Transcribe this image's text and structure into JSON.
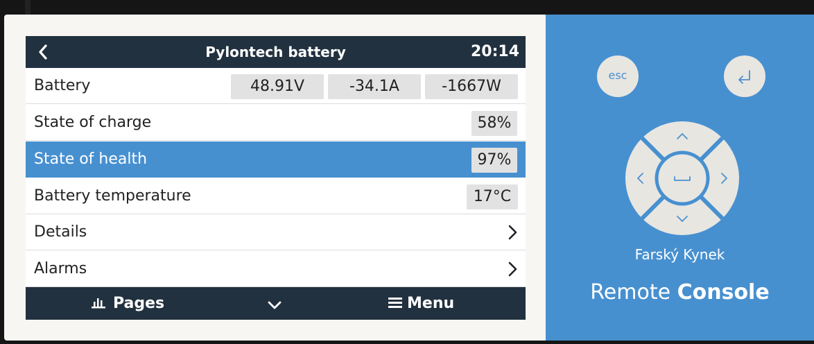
{
  "header": {
    "title": "Pylontech battery",
    "time": "20:14"
  },
  "rows": [
    {
      "label": "Battery",
      "values": [
        "48.91V",
        "-34.1A",
        "-1667W"
      ]
    },
    {
      "label": "State of charge",
      "value": "58%"
    },
    {
      "label": "State of health",
      "value": "97%",
      "selected": true
    },
    {
      "label": "Battery temperature",
      "value": "17°C"
    },
    {
      "label": "Details"
    },
    {
      "label": "Alarms"
    }
  ],
  "footer": {
    "pages_label": "Pages",
    "menu_label": "Menu"
  },
  "remote": {
    "esc_label": "esc",
    "device_name": "Farský Kynek",
    "title_light": "Remote",
    "title_bold": "Console"
  },
  "colors": {
    "accent": "#4790d0",
    "bar": "#22313f"
  },
  "icons": [
    "back-icon",
    "chevron-right-icon",
    "bar-chart-icon",
    "chevron-down-icon",
    "hamburger-icon",
    "enter-icon",
    "arrow-up-icon",
    "arrow-down-icon",
    "arrow-left-icon",
    "arrow-right-icon",
    "space-icon"
  ]
}
